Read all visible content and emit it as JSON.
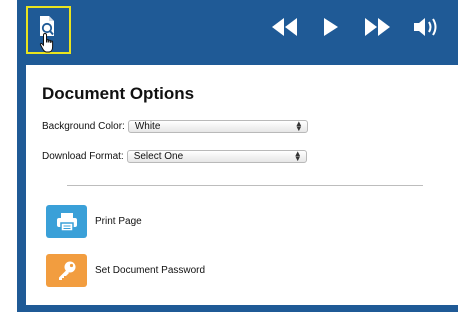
{
  "theme": {
    "frame_color": "#1f5a96",
    "highlight_border": "#e9e31e",
    "print_tile": "#3aa0d8",
    "password_tile": "#f29d3f"
  },
  "toolbar": {
    "document_tool_icon": "document-magnifier-icon",
    "cursor_icon": "hand-pointer-icon",
    "controls": [
      {
        "name": "rewind-icon"
      },
      {
        "name": "play-icon"
      },
      {
        "name": "fast-forward-icon"
      },
      {
        "name": "volume-icon"
      }
    ]
  },
  "panel": {
    "title": "Document Options",
    "background_color": {
      "label": "Background Color:",
      "value": "White"
    },
    "download_format": {
      "label": "Download Format:",
      "value": "Select One"
    },
    "actions": {
      "print": {
        "label": "Print Page",
        "icon": "printer-icon"
      },
      "password": {
        "label": "Set Document Password",
        "icon": "key-icon"
      }
    }
  }
}
